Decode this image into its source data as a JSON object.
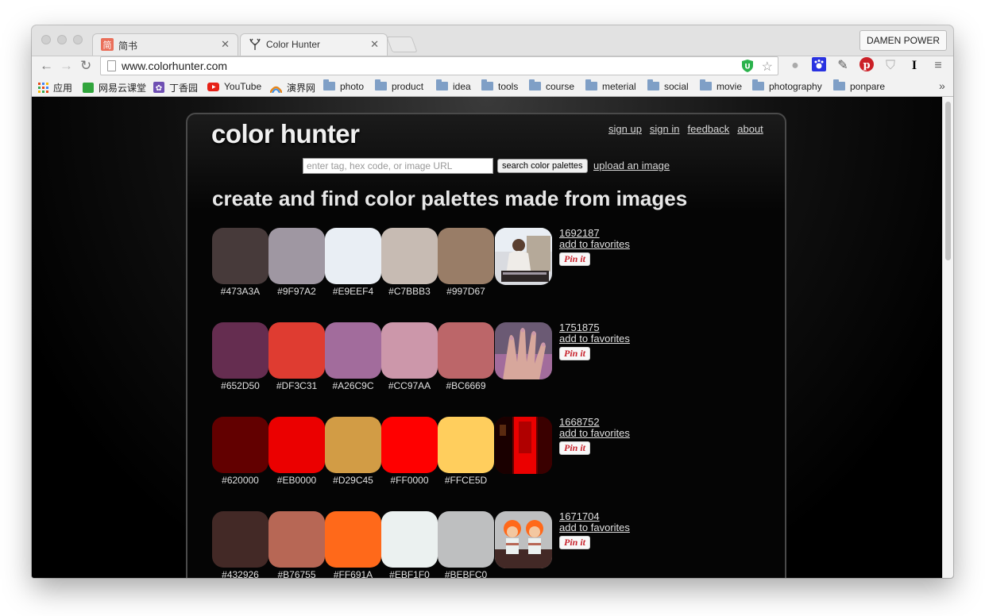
{
  "browser": {
    "tabs": [
      {
        "title": "简书",
        "favicon": "jianshu-icon",
        "active": false
      },
      {
        "title": "Color Hunter",
        "favicon": "antler-icon",
        "active": true
      }
    ],
    "profile_name": "DAMEN POWER",
    "url": "www.colorhunter.com",
    "bookmarks": [
      {
        "label": "应用",
        "icon": "apps-grid-icon"
      },
      {
        "label": "网易云课堂",
        "icon": "netease-icon"
      },
      {
        "label": "丁香园",
        "icon": "dxy-icon"
      },
      {
        "label": "YouTube",
        "icon": "youtube-icon"
      },
      {
        "label": "演界网",
        "icon": "yanjie-icon"
      },
      {
        "label": "photo",
        "icon": "folder-icon"
      },
      {
        "label": "product",
        "icon": "folder-icon"
      },
      {
        "label": "idea",
        "icon": "folder-icon"
      },
      {
        "label": "tools",
        "icon": "folder-icon"
      },
      {
        "label": "course",
        "icon": "folder-icon"
      },
      {
        "label": "meterial",
        "icon": "folder-icon"
      },
      {
        "label": "social",
        "icon": "folder-icon"
      },
      {
        "label": "movie",
        "icon": "folder-icon"
      },
      {
        "label": "photography",
        "icon": "folder-icon"
      },
      {
        "label": "ponpare",
        "icon": "folder-icon"
      }
    ],
    "overflow_chevron": "»"
  },
  "site": {
    "logo": "color hunter",
    "nav": [
      "sign up",
      "sign in",
      "feedback",
      "about"
    ],
    "search_placeholder": "enter tag, hex code, or image URL",
    "search_button": "search color palettes",
    "upload_link": "upload an image",
    "headline": "create and find color palettes made from images",
    "favorite_label": "add to favorites",
    "pin_label": "Pin it"
  },
  "palettes": [
    {
      "id": "1692187",
      "colors": [
        "#473A3A",
        "#9F97A2",
        "#E9EEF4",
        "#C7BBB3",
        "#997D67"
      ],
      "image": "musician-photo"
    },
    {
      "id": "1751875",
      "colors": [
        "#652D50",
        "#DF3C31",
        "#A26C9C",
        "#CC97AA",
        "#BC6669"
      ],
      "image": "manicured-hand-photo"
    },
    {
      "id": "1668752",
      "colors": [
        "#620000",
        "#EB0000",
        "#D29C45",
        "#FF0000",
        "#FFCE5D"
      ],
      "image": "red-interior-photo"
    },
    {
      "id": "1671704",
      "colors": [
        "#432926",
        "#B76755",
        "#FF691A",
        "#EBF1F0",
        "#BEBFC0"
      ],
      "image": "toy-figures-photo"
    }
  ]
}
